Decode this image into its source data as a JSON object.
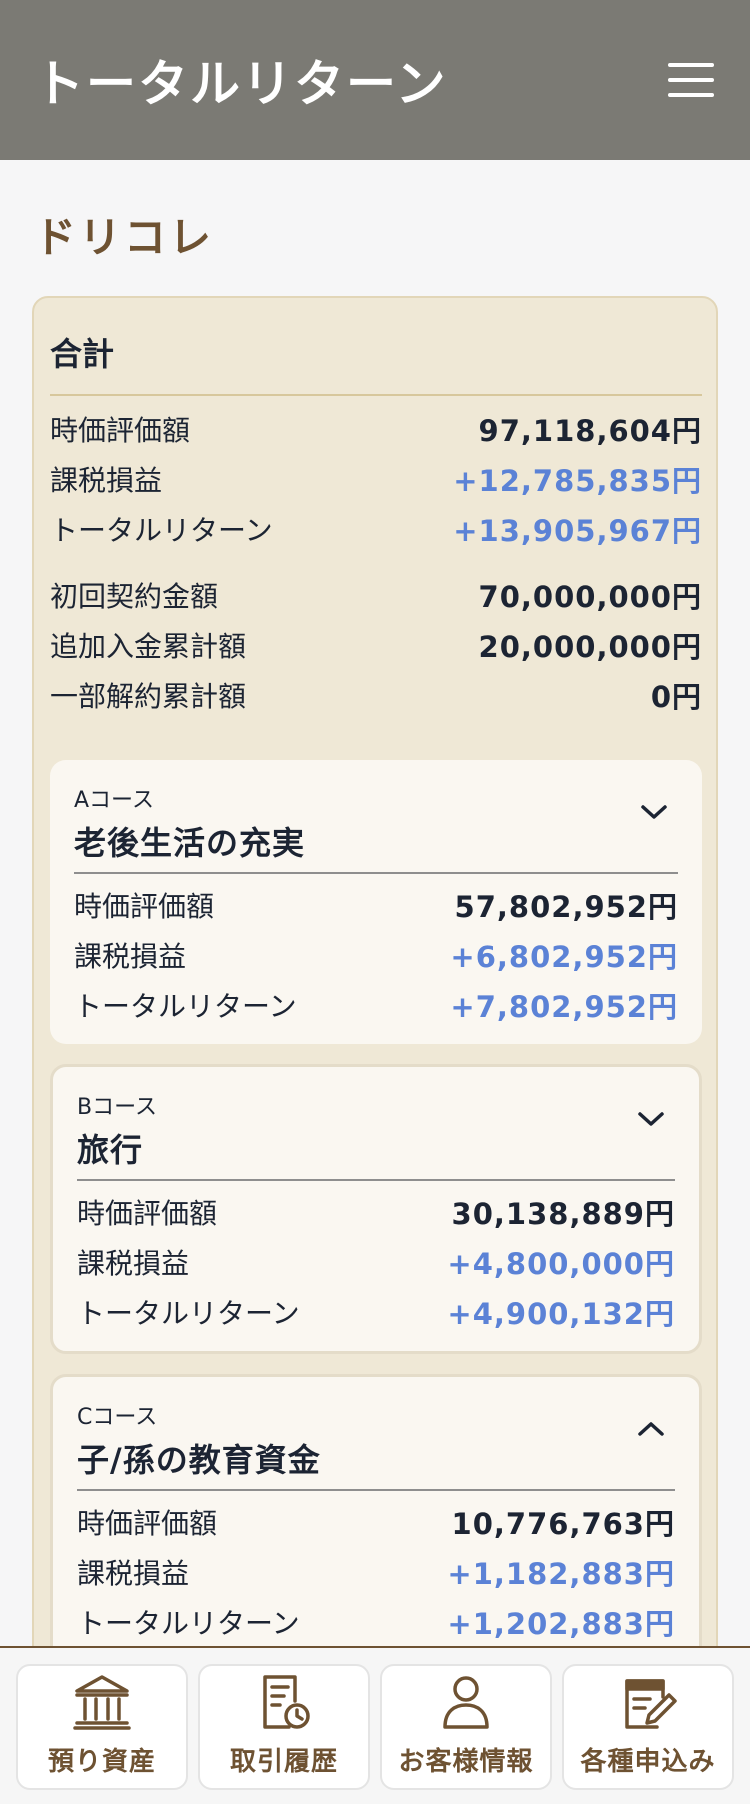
{
  "header": {
    "title": "トータルリターン",
    "menu_icon": "hamburger-menu-icon"
  },
  "section_title": "ドリコレ",
  "total": {
    "heading": "合計",
    "rows": [
      {
        "label": "時価評価額",
        "value": "97,118,604円",
        "positive": false
      },
      {
        "label": "課税損益",
        "value": "+12,785,835円",
        "positive": true
      },
      {
        "label": "トータルリターン",
        "value": "+13,905,967円",
        "positive": true
      }
    ],
    "rows2": [
      {
        "label": "初回契約金額",
        "value": "70,000,000円"
      },
      {
        "label": "追加入金累計額",
        "value": "20,000,000円"
      },
      {
        "label": "一部解約累計額",
        "value": "0円"
      }
    ]
  },
  "courses": [
    {
      "label": "Aコース",
      "name": "老後生活の充実",
      "expanded": false,
      "rows": [
        {
          "label": "時価評価額",
          "value": "57,802,952円"
        },
        {
          "label": "課税損益",
          "value": "+6,802,952円"
        },
        {
          "label": "トータルリターン",
          "value": "+7,802,952円"
        }
      ]
    },
    {
      "label": "Bコース",
      "name": "旅行",
      "expanded": false,
      "rows": [
        {
          "label": "時価評価額",
          "value": "30,138,889円"
        },
        {
          "label": "課税損益",
          "value": "+4,800,000円"
        },
        {
          "label": "トータルリターン",
          "value": "+4,900,132円"
        }
      ]
    },
    {
      "label": "Cコース",
      "name": "子/孫の教育資金",
      "expanded": true,
      "rows": [
        {
          "label": "時価評価額",
          "value": "10,776,763円"
        },
        {
          "label": "課税損益",
          "value": "+1,182,883円"
        },
        {
          "label": "トータルリターン",
          "value": "+1,202,883円"
        }
      ]
    }
  ],
  "bottom_nav": [
    {
      "label": "預り資産",
      "icon": "bank-icon"
    },
    {
      "label": "取引履歴",
      "icon": "document-clock-icon"
    },
    {
      "label": "お客様情報",
      "icon": "user-icon"
    },
    {
      "label": "各種申込み",
      "icon": "form-pen-icon"
    }
  ],
  "colors": {
    "header_bg": "#7b7a74",
    "accent_brown": "#6e5232",
    "positive_blue": "#5b82d6",
    "card_bg": "#efe8d6"
  }
}
